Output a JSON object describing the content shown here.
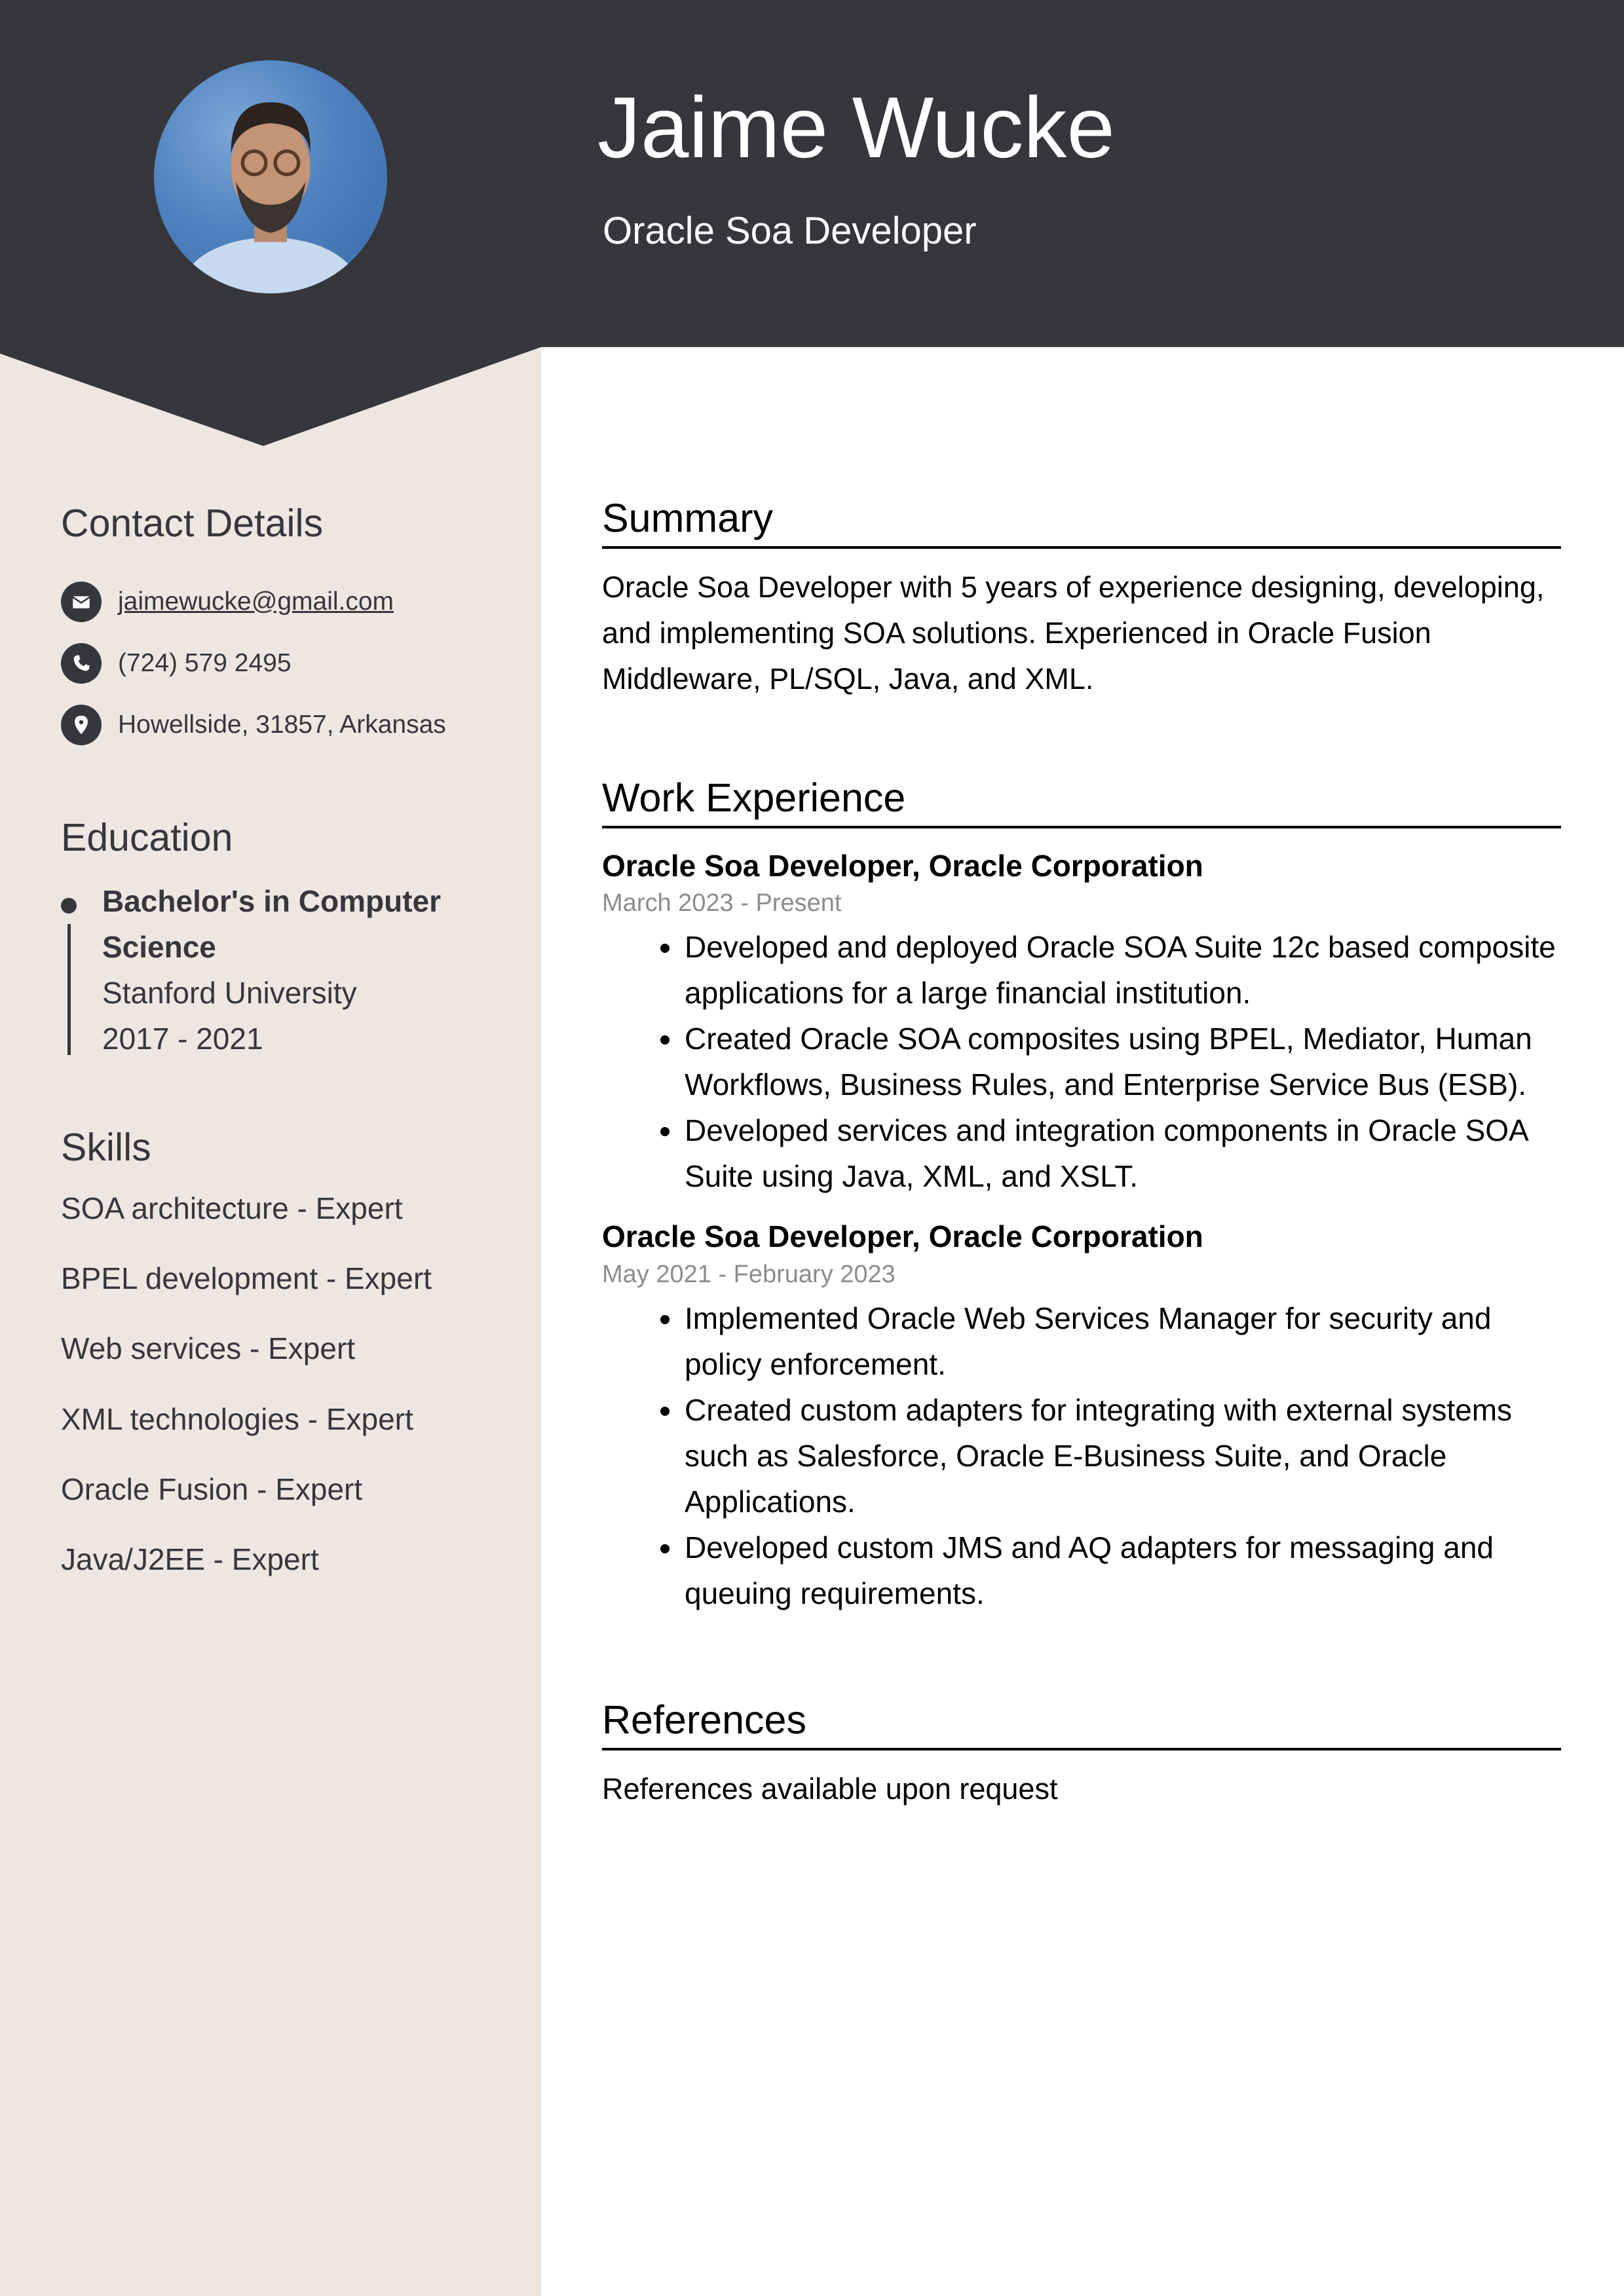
{
  "header": {
    "name": "Jaime Wucke",
    "job_title": "Oracle Soa Developer",
    "photo_alt": "profile-photo"
  },
  "colors": {
    "header_bg": "#36373d",
    "sidebar_bg": "#ede6e1",
    "text_dark": "#36373d",
    "date_gray": "#8c8c8c"
  },
  "sidebar": {
    "contact": {
      "heading": "Contact Details",
      "items": [
        {
          "icon": "envelope-icon",
          "text": "jaimewucke@gmail.com"
        },
        {
          "icon": "phone-icon",
          "text": "(724) 579 2495"
        },
        {
          "icon": "location-pin-icon",
          "text": "Howellside, 31857, Arkansas"
        }
      ]
    },
    "education": {
      "heading": "Education",
      "degree_line1": "Bachelor's in Computer",
      "degree_line2": "Science",
      "school": "Stanford University",
      "years": "2017 - 2021"
    },
    "skills": {
      "heading": "Skills",
      "items": [
        "SOA architecture - Expert",
        "BPEL development - Expert",
        "Web services - Expert",
        "XML technologies - Expert",
        "Oracle Fusion - Expert",
        "Java/J2EE - Expert"
      ]
    }
  },
  "main": {
    "summary": {
      "heading": "Summary",
      "text": "Oracle Soa Developer with 5 years of experience designing, developing, and implementing SOA solutions. Experienced in Oracle Fusion Middleware, PL/SQL, Java, and XML."
    },
    "work": {
      "heading": "Work Experience",
      "jobs": [
        {
          "title": "Oracle Soa Developer, Oracle Corporation",
          "dates": "March 2023 - Present",
          "bullets": [
            "Developed and deployed Oracle SOA Suite 12c based composite applications for a large financial institution.",
            "Created Oracle SOA composites using BPEL, Mediator, Human Workflows, Business Rules, and Enterprise Service Bus (ESB).",
            "Developed services and integration components in Oracle SOA Suite using Java, XML, and XSLT."
          ]
        },
        {
          "title": "Oracle Soa Developer, Oracle Corporation",
          "dates": "May 2021 - February 2023",
          "bullets": [
            "Implemented Oracle Web Services Manager for security and policy enforcement.",
            "Created custom adapters for integrating with external systems such as Salesforce, Oracle E-Business Suite, and Oracle Applications.",
            "Developed custom JMS and AQ adapters for messaging and queuing requirements."
          ]
        }
      ]
    },
    "references": {
      "heading": "References",
      "text": "References available upon request"
    }
  }
}
